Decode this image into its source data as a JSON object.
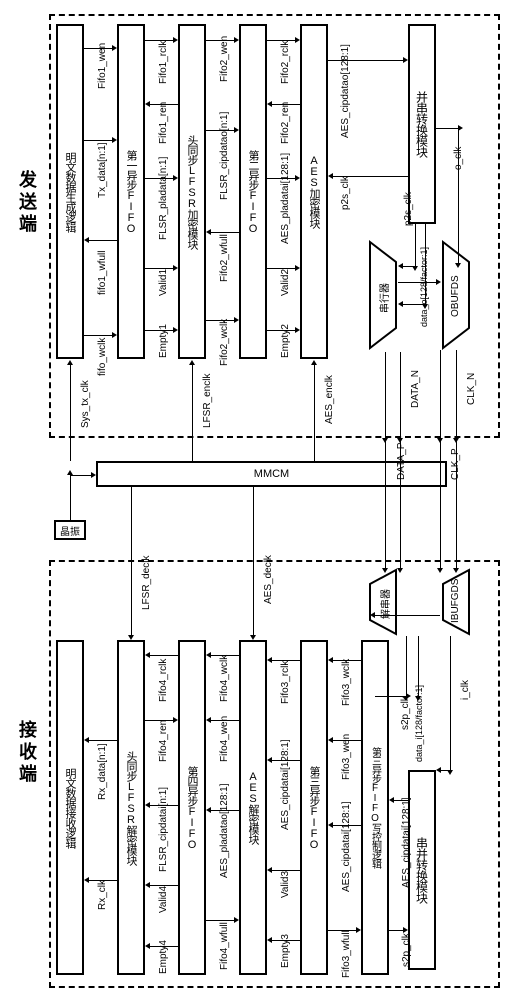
{
  "titles": {
    "tx": "发送端",
    "rx": "接收端"
  },
  "tx": {
    "plaintext_gen": "明文数据生成逻辑",
    "fifo1": "第一异步FIFO",
    "lfsr_enc": "头同步LFSR加密模块",
    "fifo2": "第二异步FIFO",
    "aes_enc": "AES加密模块",
    "p2s": "并串转换模块",
    "serializer": "串行器",
    "obufds": "OBUFDS"
  },
  "rx": {
    "plaintext_recv": "明文数据接收逻辑",
    "lfsr_dec": "头同步LFSR解密模块",
    "fifo4": "第四异步FIFO",
    "aes_dec": "AES解密模块",
    "fifo3": "第三异步FIFO",
    "fifo3_ctrl": "第三异步FIFO写控制逻辑",
    "s2p": "串并转换模块",
    "deser": "解串器",
    "ibufgds": "IBUFGDS"
  },
  "mid": {
    "mmcm": "MMCM",
    "xtal": "晶振"
  },
  "sig": {
    "fifo1_wen": "Fifo1_wen",
    "tx_data": "Tx_data[n:1]",
    "fifo1_wfull": "fifo1_wfull",
    "fifo_wclk": "fifo_wclk",
    "fifo1_rclk": "Fifo1_rclk",
    "fifo1_ren": "Fifo1_ren",
    "flsr_pladata": "FLSR_pladata[n:1]",
    "valid1": "Valid1",
    "empty1": "Empty1",
    "fifo2_wen": "Fifo2_wen",
    "flsr_cipdatao": "FLSR_cipdatao[n:1]",
    "fifo2_wfull": "Fifo2_wfull",
    "fifo2_wclk": "Fifo2_wclk",
    "fifo2_rclk": "Fifo2_rclk",
    "fifo2_ren": "Fifo2_ren",
    "aes_pladatai": "AES_pladatai[128:1]",
    "valid2": "Valid2",
    "empty2": "Empty2",
    "aes_cipdatao": "AES_cipdatao[128:1]",
    "p2s_clk": "p2s_clk",
    "data_o": "data_o[128/factor:1]",
    "o_clk": "o_clk",
    "clk_p": "CLK_P",
    "clk_n": "CLK_N",
    "data_p": "DATA_P",
    "data_n": "DATA_N",
    "sys_tx_clk": "Sys_tx_clk",
    "lfsr_enclk": "LFSR_enclk",
    "aes_enclk": "AES_enclk",
    "i_clk": "i_clk",
    "data_i": "data_i[128/factor:1]",
    "s2p_clk": "s2p_clk",
    "aes_cipdatai": "AES_cipdatai[128:1]",
    "fifo3_wclk": "Fifo3_wclk",
    "fifo3_wen": "Fifo3_wen",
    "aes_cipdatai2": "AES_cipdatai[128:1]",
    "fifo3_wfull": "Fifo3_wfull",
    "fifo3_rclk": "Fifo3_rclk",
    "aes_cipdatai3": "AES_cipdatai[128:1]",
    "valid3": "Valid3",
    "empty3": "Empty3",
    "fifo4_wclk": "Fifo4_wclk",
    "fifo4_wen": "Fifo4_wen",
    "aes_pladatao": "AES_pladatao[128:1]",
    "fifo4_wfull": "Fifo4_wfull",
    "fifo4_rclk": "Fifo4_rclk",
    "fifo4_ren": "Fifo4_ren",
    "flsr_cipdatai": "FLSR_cipdatai[n:1]",
    "valid4": "Valid4",
    "empty4": "Empty4",
    "rx_data": "Rx_data[n:1]",
    "rx_clk": "Rx_clk",
    "lfsr_declk": "LFSR_declk",
    "aes_declk": "AES_declk"
  }
}
